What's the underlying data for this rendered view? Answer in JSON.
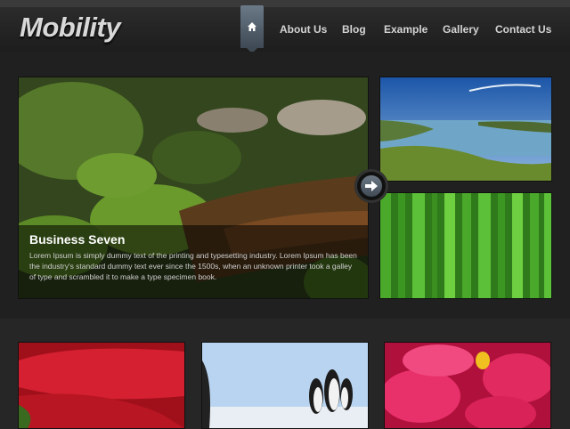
{
  "header": {
    "logo": "Mobility",
    "nav": [
      {
        "label": "About Us"
      },
      {
        "label": "Blog"
      },
      {
        "label": "Example"
      },
      {
        "label": "Gallery"
      },
      {
        "label": "Contact Us"
      }
    ],
    "home_icon": "home-icon"
  },
  "slider": {
    "title": "Business Seven",
    "text": "Lorem Ipsum is simply dummy text of the printing and typesetting industry. Lorem Ipsum has been the industry's standard dummy text ever since the 1500s, when an unknown printer took a galley of type and scrambled it to make a type specimen book.",
    "next_icon": "arrow-right-icon"
  },
  "colors": {
    "background": "#262626",
    "nav_active": "#5a6774",
    "text": "#d4d4d4"
  }
}
